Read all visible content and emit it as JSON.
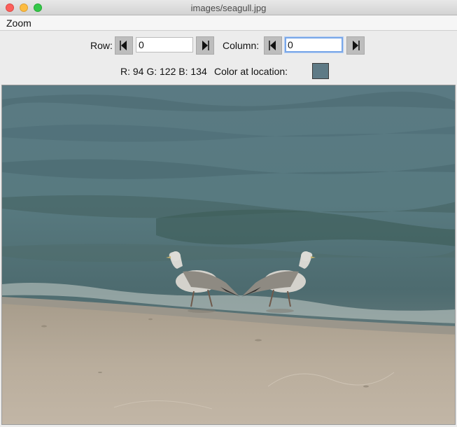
{
  "window": {
    "title": "images/seagull.jpg"
  },
  "menu": {
    "zoom_label": "Zoom"
  },
  "controls": {
    "row_label": "Row:",
    "row_value": "0",
    "column_label": "Column:",
    "column_value": "0",
    "rgb_text": "R: 94 G: 122 B: 134",
    "color_label": "Color at location:",
    "color_swatch": "#5e7a86"
  },
  "icons": {
    "prev_row": "left-arrow-icon",
    "next_row": "right-arrow-icon",
    "prev_column": "left-arrow-icon",
    "next_column": "right-arrow-icon"
  }
}
